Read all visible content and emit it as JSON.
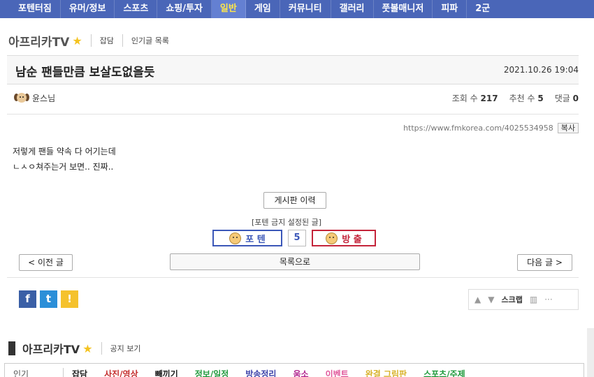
{
  "topnav": [
    {
      "label": "포텐터짐",
      "active": false
    },
    {
      "label": "유머/정보",
      "active": false
    },
    {
      "label": "스포츠",
      "active": false
    },
    {
      "label": "쇼핑/투자",
      "active": false
    },
    {
      "label": "일반",
      "active": true
    },
    {
      "label": "게임",
      "active": false
    },
    {
      "label": "커뮤니티",
      "active": false
    },
    {
      "label": "갤러리",
      "active": false
    },
    {
      "label": "풋볼매니저",
      "active": false
    },
    {
      "label": "피파",
      "active": false
    },
    {
      "label": "2군",
      "active": false
    }
  ],
  "board": {
    "name": "아프리카TV",
    "links": [
      "잡담",
      "인기글 목록"
    ]
  },
  "post": {
    "title": "남순 팬들만큼 보살도없을듯",
    "date": "2021.10.26 19:04",
    "author": "윤스님",
    "views_label": "조회 수",
    "views": "217",
    "recommend_label": "추천 수",
    "recommend": "5",
    "comments_label": "댓글",
    "comments": "0",
    "url": "https://www.fmkorea.com/4025534958",
    "copy_label": "복사",
    "body": [
      "저렇게 팬들 약속 다 어기는데",
      "ㄴㅅㅇ쳐주는거 보면.. 진짜.."
    ]
  },
  "buttons": {
    "history": "게시판 이력",
    "forbid_note": "[포텐 금지 설정된 글]",
    "vote_up": "포 텐",
    "vote_count": "5",
    "vote_down": "방 출",
    "prev": "< 이전 글",
    "list": "목록으로",
    "next": "다음 글 >"
  },
  "share": [
    "f",
    "t",
    "!"
  ],
  "toolbar": {
    "up_icon": "▲",
    "down_icon": "▼",
    "scrap": "스크랩",
    "more": "···"
  },
  "footer": {
    "board": "아프리카TV",
    "notice": "공지 보기"
  },
  "category_tabs": [
    {
      "label": "인기",
      "color": "#555555"
    },
    {
      "label": "잡담",
      "color": "#222222"
    },
    {
      "label": "사진/영상",
      "color": "#c42c2c"
    },
    {
      "label": "빼끼기",
      "color": "#222222"
    },
    {
      "label": "정보/일정",
      "color": "#1f9a3c"
    },
    {
      "label": "방송정리",
      "color": "#3a3fa8"
    },
    {
      "label": "움소",
      "color": "#b1238e"
    },
    {
      "label": "이벤트",
      "color": "#e0579a"
    },
    {
      "label": "완결 그림판",
      "color": "#d8b22a"
    },
    {
      "label": "스포츠/주제",
      "color": "#1f9a3c"
    }
  ]
}
